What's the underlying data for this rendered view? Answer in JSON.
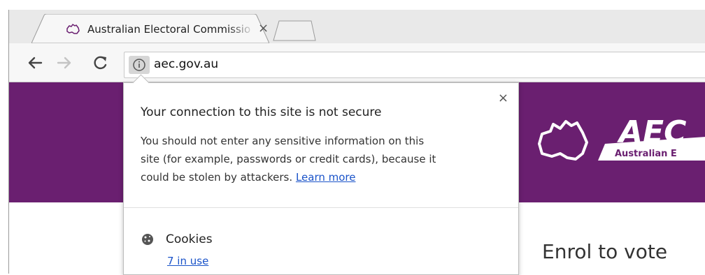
{
  "tab": {
    "title": "Australian Electoral Commission",
    "close_glyph": "×"
  },
  "toolbar": {
    "back_icon": "back-arrow-icon",
    "forward_icon": "forward-arrow-icon",
    "reload_icon": "reload-icon",
    "info_icon": "info-icon"
  },
  "omnibox": {
    "url": "aec.gov.au"
  },
  "page": {
    "logo_text": "AEC",
    "logo_subtext": "Australian E",
    "heading": "Enrol to vote",
    "brand_color": "#6a1f70"
  },
  "popup": {
    "close_glyph": "×",
    "title": "Your connection to this site is not secure",
    "body_line1": "You should not enter any sensitive information on this",
    "body_line2": "site (for example, passwords or credit cards), because it",
    "body_line3_prefix": "could be stolen by attackers.",
    "learn_more": "Learn more",
    "cookies_label": "Cookies",
    "cookies_link": "7 in use"
  }
}
